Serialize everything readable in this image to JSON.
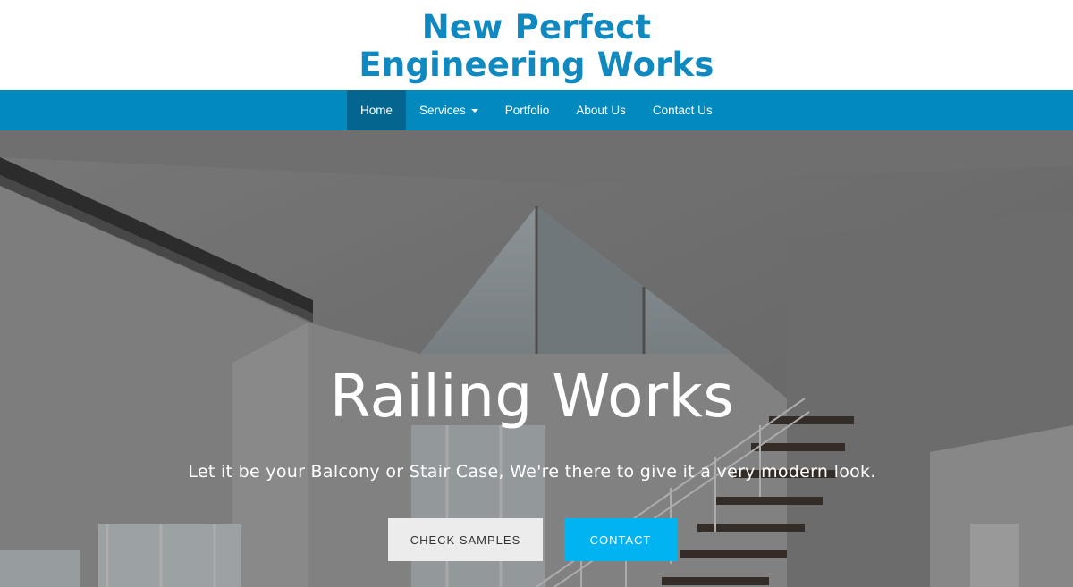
{
  "brand": {
    "line1": "New Perfect",
    "line2": "Engineering Works"
  },
  "nav": {
    "items": [
      {
        "label": "Home",
        "active": true
      },
      {
        "label": "Services",
        "has_dropdown": true
      },
      {
        "label": "Portfolio"
      },
      {
        "label": "About Us"
      },
      {
        "label": "Contact Us"
      }
    ]
  },
  "hero": {
    "title": "Railing Works",
    "subtitle": "Let it be your Balcony or Stair Case, We're there to give it a very modern look.",
    "buttons": {
      "samples_label": "CHECK SAMPLES",
      "contact_label": "CONTACT"
    }
  },
  "colors": {
    "brand": "#0f89bf",
    "navbar": "#0289bd",
    "nav_active": "#04668e",
    "contact_button": "#00b4f1",
    "samples_button": "#ececec"
  },
  "icons": {
    "dropdown": "caret-down-icon"
  }
}
